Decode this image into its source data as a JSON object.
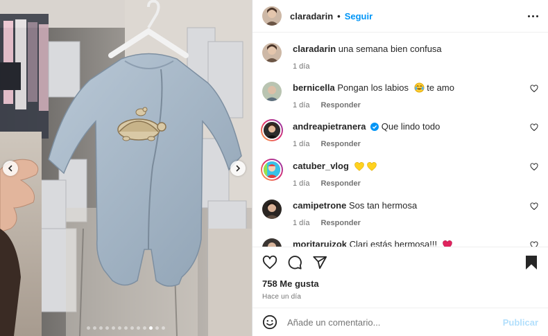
{
  "post": {
    "header": {
      "username": "claradarin",
      "separator": "•",
      "follow_label": "Seguir",
      "more_icon": "more-horizontal-icon"
    },
    "caption": {
      "username": "claradarin",
      "text": "una semana bien confusa",
      "time": "1 día"
    },
    "comments": [
      {
        "username": "bernicella",
        "text": "Pongan los labios",
        "emoji": "tears-of-joy-emoji",
        "text_after": "te amo",
        "time": "1 día",
        "reply_label": "Responder",
        "story_ring": false
      },
      {
        "username": "andreapietranera",
        "verified": true,
        "text": "Que lindo todo",
        "time": "1 día",
        "reply_label": "Responder",
        "story_ring": true
      },
      {
        "username": "catuber_vlog",
        "text": "",
        "emoji": "yellow-heart-emoji x2",
        "time": "1 día",
        "reply_label": "Responder",
        "story_ring": true
      },
      {
        "username": "camipetrone",
        "text": "Sos tan hermosa",
        "time": "1 día",
        "reply_label": "Responder",
        "story_ring": false
      },
      {
        "username": "moritaruizok",
        "text": "Clari estás hermosa!!!",
        "emoji": "red-heart-emoji",
        "story_ring": false
      }
    ],
    "actions": {
      "like_icon": "heart-icon",
      "comment_icon": "comment-icon",
      "share_icon": "share-icon",
      "save_icon": "bookmark-filled-icon"
    },
    "likes": "758 Me gusta",
    "posted_ago": "Hace un día",
    "add_comment": {
      "placeholder": "Añade un comentario...",
      "publish_label": "Publicar"
    },
    "carousel": {
      "slide_count": 13,
      "active_index": 10
    },
    "colors": {
      "accent": "#0095f6",
      "publish_disabled": "#b2dffc",
      "text": "#262626",
      "secondary": "#737373",
      "verified": "#0095f6"
    }
  }
}
